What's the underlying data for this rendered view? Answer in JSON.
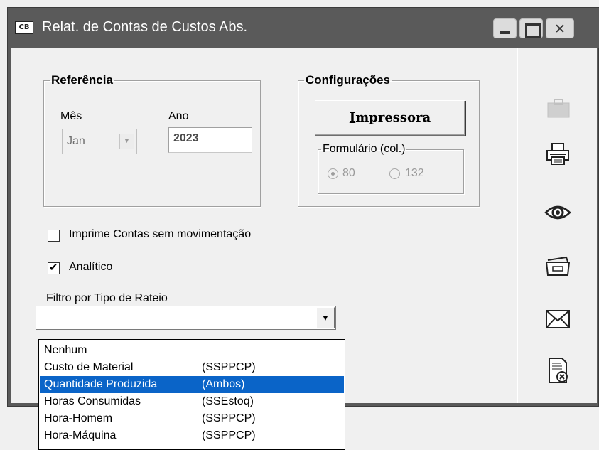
{
  "window": {
    "title": "Relat. de Contas de Custos Abs.",
    "app_icon_text": "CB"
  },
  "referencia": {
    "legend": "Referência",
    "mes_label": "Mês",
    "ano_label": "Ano",
    "mes_value": "Jan",
    "ano_value": "2023"
  },
  "configuracoes": {
    "legend": "Configurações",
    "printer_button_prefix": "I",
    "printer_button_rest": "mpressora",
    "formulario_legend": "Formulário (col.)",
    "option_80": "80",
    "option_132": "132",
    "selected": "80"
  },
  "options": {
    "sem_movimentacao_label": "Imprime Contas sem movimentação",
    "sem_movimentacao_checked": false,
    "analitico_label": "Analítico",
    "analitico_checked": true
  },
  "filtro": {
    "label": "Filtro por Tipo de Rateio",
    "value": "",
    "items": [
      {
        "name": "Nenhum",
        "code": ""
      },
      {
        "name": "Custo de Material",
        "code": "(SSPPCP)"
      },
      {
        "name": "Quantidade Produzida",
        "code": "(Ambos)"
      },
      {
        "name": "Horas Consumidas",
        "code": "(SSEstoq)"
      },
      {
        "name": "Hora-Homem",
        "code": "(SSPPCP)"
      },
      {
        "name": "Hora-Máquina",
        "code": "(SSPPCP)"
      }
    ],
    "selected_index": 2
  },
  "sidebar_icons": [
    "briefcase-icon",
    "printer-icon",
    "preview-eye-icon",
    "save-file-icon",
    "email-envelope-icon",
    "document-cancel-icon"
  ]
}
